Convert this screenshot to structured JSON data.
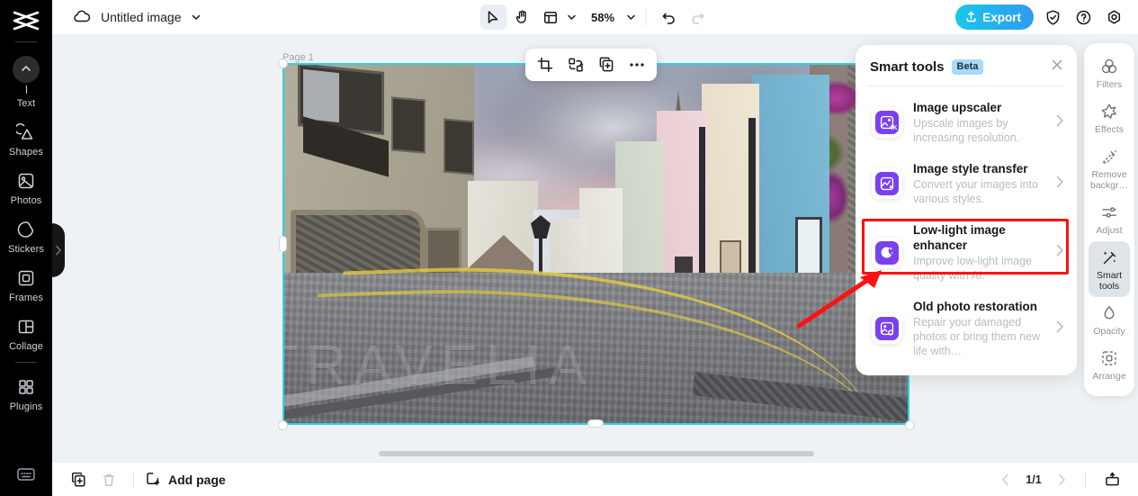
{
  "app": {
    "logo_icon": "capcut-logo-icon"
  },
  "left_rail": {
    "items": [
      {
        "label": "Text",
        "icon": "text-icon"
      },
      {
        "label": "Shapes",
        "icon": "shapes-icon"
      },
      {
        "label": "Photos",
        "icon": "photos-icon"
      },
      {
        "label": "Stickers",
        "icon": "stickers-icon"
      },
      {
        "label": "Frames",
        "icon": "frames-icon"
      },
      {
        "label": "Collage",
        "icon": "collage-icon"
      },
      {
        "label": "Plugins",
        "icon": "plugins-icon"
      }
    ],
    "bottom_icon": "keyboard-icon"
  },
  "topbar": {
    "cloud_icon": "cloud-save-icon",
    "document_title": "Untitled image",
    "title_caret_icon": "chevron-down-icon",
    "tools": [
      {
        "name": "select-tool",
        "icon": "cursor-arrow-icon",
        "active": true
      },
      {
        "name": "hand-tool",
        "icon": "hand-icon",
        "active": false
      },
      {
        "name": "layout-tool",
        "icon": "layout-panel-icon",
        "active": false
      }
    ],
    "layout_caret_icon": "chevron-down-icon",
    "zoom_value": "58%",
    "zoom_caret_icon": "chevron-down-icon",
    "undo_icon": "undo-icon",
    "redo_icon": "redo-icon",
    "export_label": "Export",
    "export_icon": "upload-icon",
    "export_gradient_from": "#18c8e8",
    "export_gradient_to": "#2f9bf0",
    "right_icons": [
      {
        "name": "shield-check-icon"
      },
      {
        "name": "help-question-icon"
      },
      {
        "name": "settings-gear-icon"
      }
    ]
  },
  "canvas": {
    "page_label": "Page 1",
    "selection_color": "#2ed2e6",
    "object_toolbar": [
      {
        "name": "crop-button",
        "icon": "crop-icon"
      },
      {
        "name": "flip-button",
        "icon": "flip-rotate-icon"
      },
      {
        "name": "duplicate-button",
        "icon": "duplicate-icon"
      },
      {
        "name": "more-options-button",
        "icon": "ellipsis-icon"
      }
    ],
    "image": {
      "description": "European cobblestone street with colorful terraced houses and church spire at dusk",
      "watermark_text": "TRAVELIA"
    }
  },
  "smart_tools_panel": {
    "title": "Smart tools",
    "badge": "Beta",
    "badge_color": "#a9d9fb",
    "close_icon": "close-icon",
    "accent_color": "#7b3ff2",
    "highlight_color": "#ff1111",
    "items": [
      {
        "name": "Image upscaler",
        "desc": "Upscale images by increasing resolution.",
        "icon": "image-upscale-4k-icon",
        "highlighted": false
      },
      {
        "name": "Image style transfer",
        "desc": "Convert your images into various styles.",
        "icon": "image-style-transfer-icon",
        "highlighted": false
      },
      {
        "name": "Low-light image enhancer",
        "desc": "Improve low-light image quality with AI.",
        "icon": "moon-sparkle-icon",
        "highlighted": true
      },
      {
        "name": "Old photo restoration",
        "desc": "Repair your damaged photos or bring them new life with…",
        "icon": "photo-restore-icon",
        "highlighted": false
      }
    ]
  },
  "right_rail": {
    "items": [
      {
        "label": "Filters",
        "icon": "filters-icon",
        "active": false
      },
      {
        "label": "Effects",
        "icon": "effects-star-icon",
        "active": false
      },
      {
        "label": "Remove backgr…",
        "icon": "remove-background-icon",
        "active": false
      },
      {
        "label": "Adjust",
        "icon": "adjust-sliders-icon",
        "active": false
      },
      {
        "label": "Smart tools",
        "icon": "magic-wand-icon",
        "active": true
      },
      {
        "label": "Opacity",
        "icon": "opacity-drop-icon",
        "active": false
      },
      {
        "label": "Arrange",
        "icon": "arrange-icon",
        "active": false
      }
    ]
  },
  "bottombar": {
    "duplicate_page_icon": "duplicate-page-icon",
    "delete_page_icon": "trash-icon",
    "add_page_label": "Add page",
    "add_page_icon": "add-page-icon",
    "prev_icon": "chevron-left-icon",
    "next_icon": "chevron-right-icon",
    "page_indicator": "1/1",
    "present_icon": "present-icon"
  }
}
